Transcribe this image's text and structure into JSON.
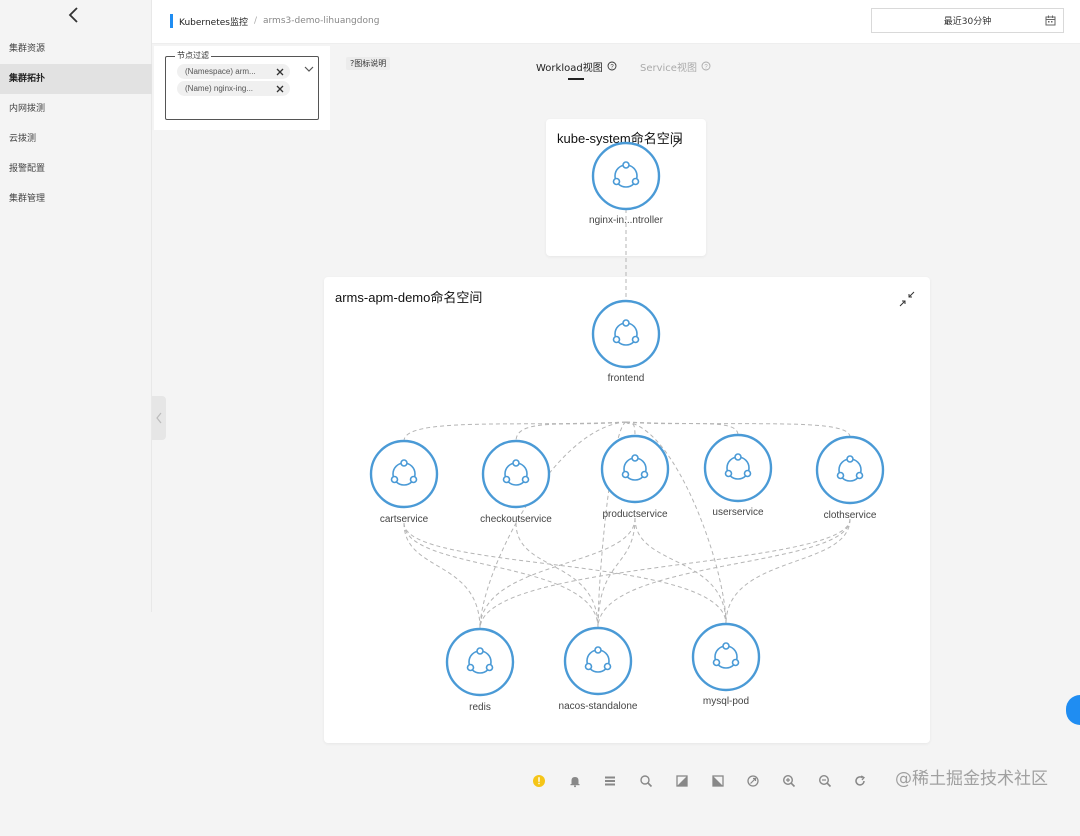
{
  "sidebar": {
    "items": [
      {
        "label": "集群资源",
        "active": false
      },
      {
        "label": "集群拓扑",
        "active": true
      },
      {
        "label": "内网拨测",
        "active": false
      },
      {
        "label": "云拨测",
        "active": false
      },
      {
        "label": "报警配置",
        "active": false
      },
      {
        "label": "集群管理",
        "active": false
      }
    ]
  },
  "header": {
    "breadcrumb_root": "Kubernetes监控",
    "breadcrumb_separator": "/",
    "breadcrumb_current": "arms3-demo-lihuangdong",
    "time_range": "最近30分钟"
  },
  "filter": {
    "legend": "节点过滤",
    "tags": [
      "(Namespace) arm...",
      "(Name) nginx-ing..."
    ]
  },
  "legend_button": "?图标说明",
  "tabs": [
    {
      "label": "Workload视图",
      "active": true
    },
    {
      "label": "Service视图",
      "active": false
    }
  ],
  "namespaces": [
    {
      "title": "kube-system命名空间"
    },
    {
      "title": "arms-apm-demo命名空间"
    }
  ],
  "nodes": [
    {
      "id": "nginx",
      "label": "nginx-in...ntroller",
      "namespace": "kube-system"
    },
    {
      "id": "frontend",
      "label": "frontend",
      "namespace": "arms-apm-demo"
    },
    {
      "id": "cart",
      "label": "cartservice",
      "namespace": "arms-apm-demo"
    },
    {
      "id": "checkout",
      "label": "checkoutservice",
      "namespace": "arms-apm-demo"
    },
    {
      "id": "product",
      "label": "productservice",
      "namespace": "arms-apm-demo"
    },
    {
      "id": "user",
      "label": "userservice",
      "namespace": "arms-apm-demo"
    },
    {
      "id": "cloth",
      "label": "clothservice",
      "namespace": "arms-apm-demo"
    },
    {
      "id": "redis",
      "label": "redis",
      "namespace": "arms-apm-demo"
    },
    {
      "id": "nacos",
      "label": "nacos-standalone",
      "namespace": "arms-apm-demo"
    },
    {
      "id": "mysql",
      "label": "mysql-pod",
      "namespace": "arms-apm-demo"
    }
  ],
  "edges": [
    [
      "nginx",
      "frontend"
    ],
    [
      "frontend",
      "cart"
    ],
    [
      "frontend",
      "checkout"
    ],
    [
      "frontend",
      "product"
    ],
    [
      "frontend",
      "user"
    ],
    [
      "frontend",
      "cloth"
    ],
    [
      "frontend",
      "redis"
    ],
    [
      "frontend",
      "nacos"
    ],
    [
      "frontend",
      "mysql"
    ],
    [
      "cart",
      "redis"
    ],
    [
      "cart",
      "nacos"
    ],
    [
      "cart",
      "mysql"
    ],
    [
      "checkout",
      "nacos"
    ],
    [
      "product",
      "redis"
    ],
    [
      "product",
      "nacos"
    ],
    [
      "product",
      "mysql"
    ],
    [
      "cloth",
      "redis"
    ],
    [
      "cloth",
      "nacos"
    ],
    [
      "cloth",
      "mysql"
    ]
  ],
  "toolbar": [
    {
      "icon": "warning-icon",
      "color": "#f5c518"
    },
    {
      "icon": "bell-icon"
    },
    {
      "icon": "list-icon"
    },
    {
      "icon": "search-icon"
    },
    {
      "icon": "layout-icon"
    },
    {
      "icon": "layout-alt-icon"
    },
    {
      "icon": "fit-view-icon"
    },
    {
      "icon": "zoom-in-icon"
    },
    {
      "icon": "zoom-out-icon"
    },
    {
      "icon": "refresh-icon"
    }
  ],
  "watermark": "@稀土掘金技术社区",
  "colors": {
    "accent": "#1f8df2",
    "node_stroke": "#4a9ad6",
    "edge": "#b5b5b5"
  }
}
